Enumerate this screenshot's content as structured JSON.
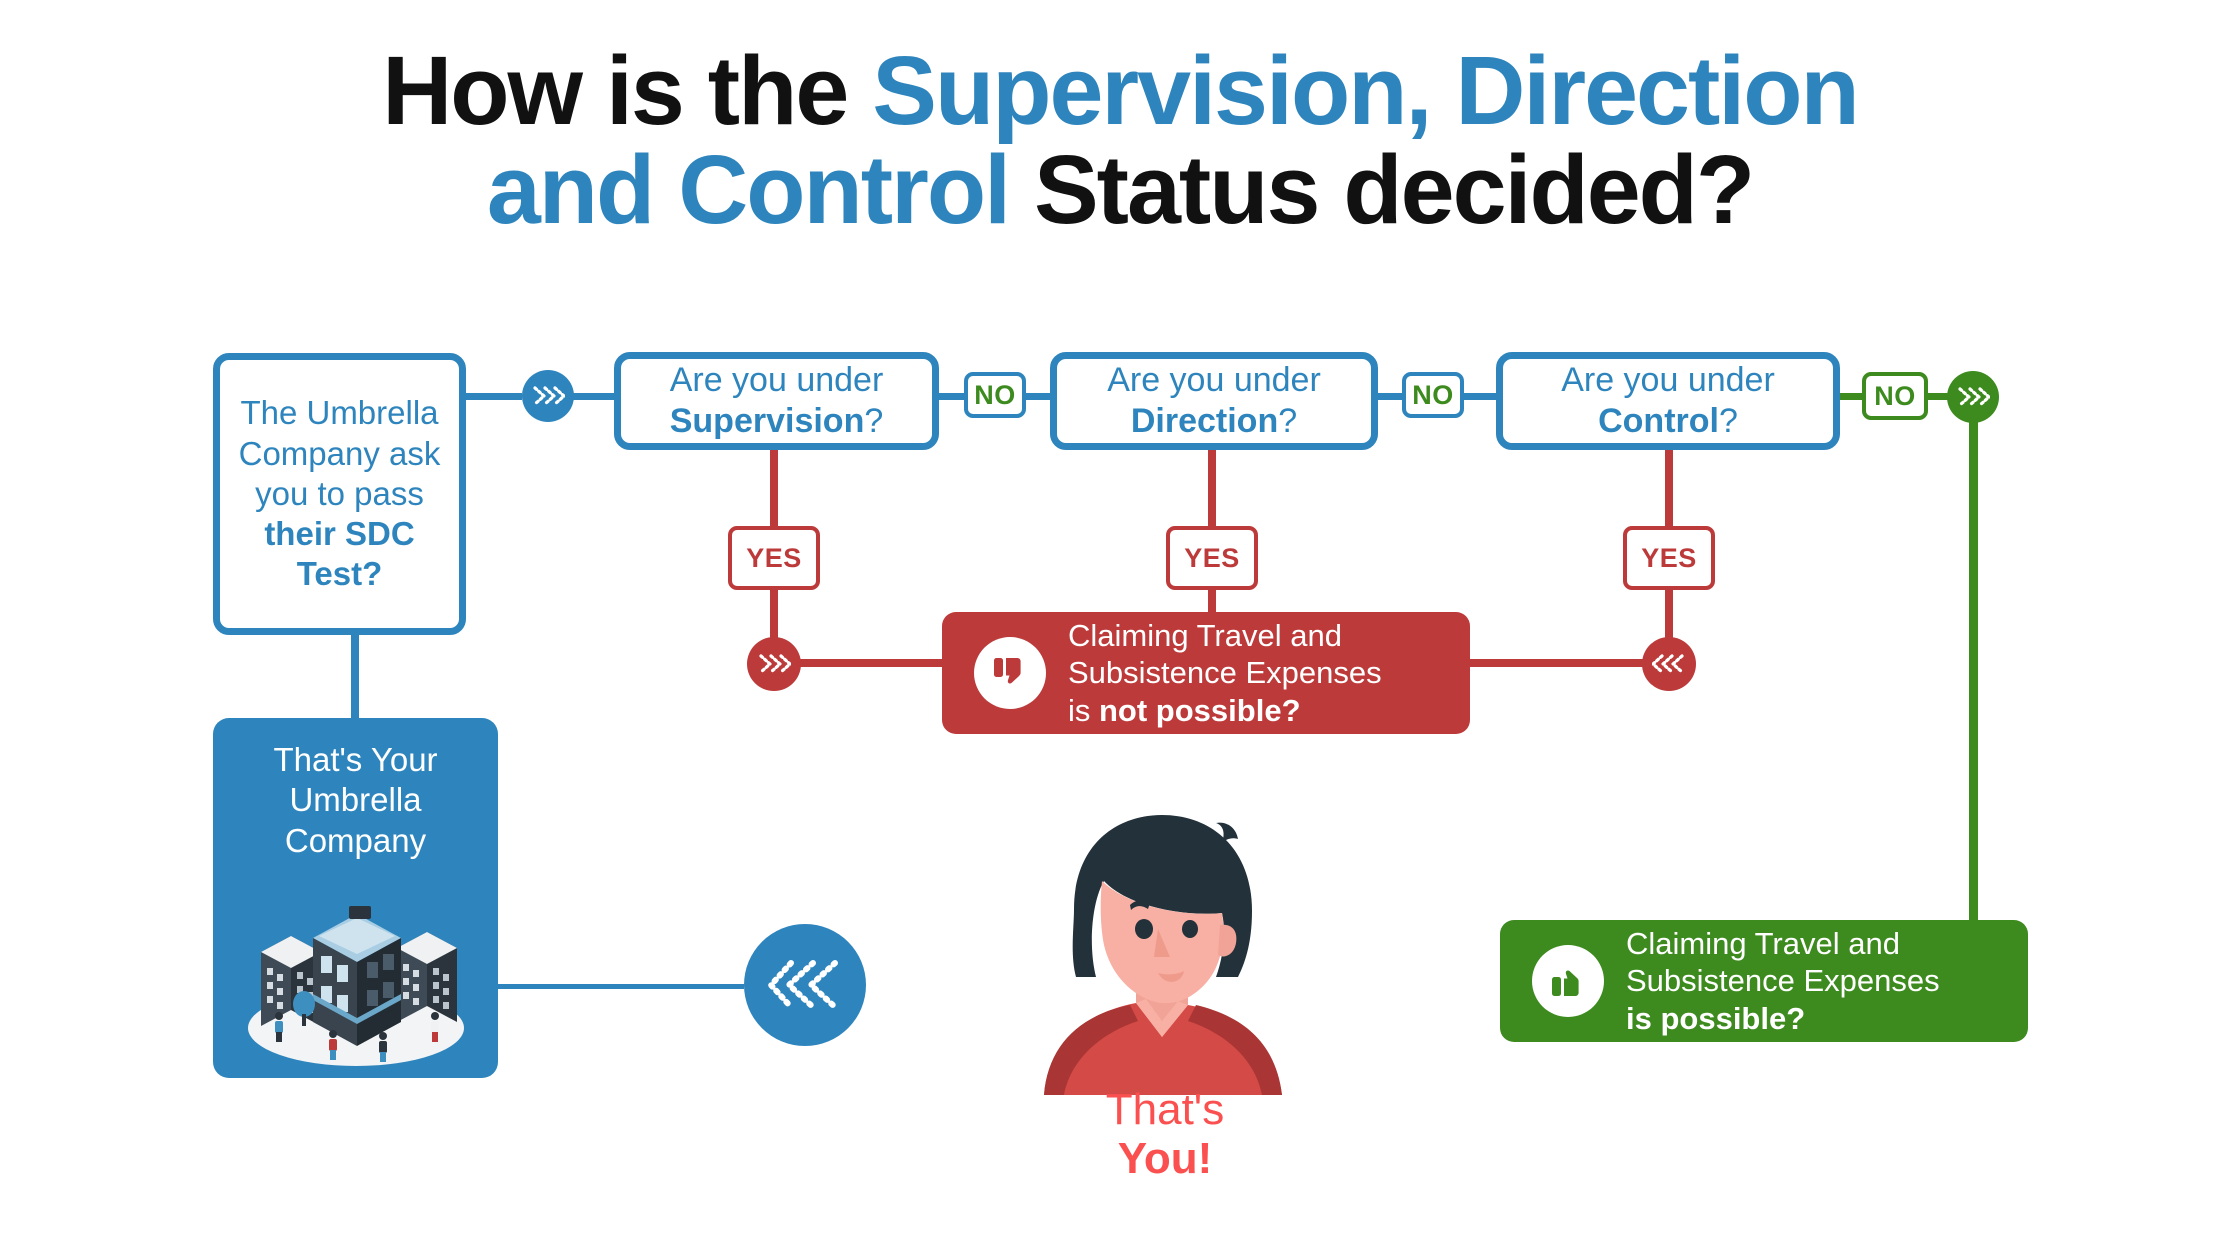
{
  "title": {
    "line1_pre": "How is the ",
    "line1_hl": "Supervision, Direction",
    "line2_hl": "and Control",
    "line2_post": " Status decided?"
  },
  "colors": {
    "blue": "#2e85bd",
    "red": "#bd3a3a",
    "green": "#3d8b1f",
    "pink": "#fb5050",
    "white": "#ffffff"
  },
  "flow": {
    "start_box": {
      "text_plain_1": "The Umbrella Company ask you to pass ",
      "text_bold": "their SDC Test?"
    },
    "questions": [
      {
        "lead": "Are you under",
        "term": "Supervision",
        "suffix": "?"
      },
      {
        "lead": "Are you under",
        "term": "Direction",
        "suffix": "?"
      },
      {
        "lead": "Are you under",
        "term": "Control",
        "suffix": "?"
      }
    ],
    "no_labels": [
      "NO",
      "NO",
      "NO"
    ],
    "yes_labels": [
      "YES",
      "YES",
      "YES"
    ],
    "result_negative": {
      "line1": "Claiming Travel and",
      "line2": "Subsistence Expenses",
      "line3_plain": "is ",
      "line3_bold": "not possible?",
      "icon": "thumbs-down-icon"
    },
    "result_positive": {
      "line1": "Claiming Travel and",
      "line2": "Subsistence Expenses",
      "line3_bold": "is possible?",
      "icon": "thumbs-up-icon"
    },
    "umbrella_panel": {
      "line1": "That's Your",
      "line2": "Umbrella",
      "line3": "Company",
      "illustration": "isometric-office-buildings"
    },
    "person_panel": {
      "line1": "That's",
      "line2": "You!",
      "illustration": "woman-avatar"
    }
  }
}
